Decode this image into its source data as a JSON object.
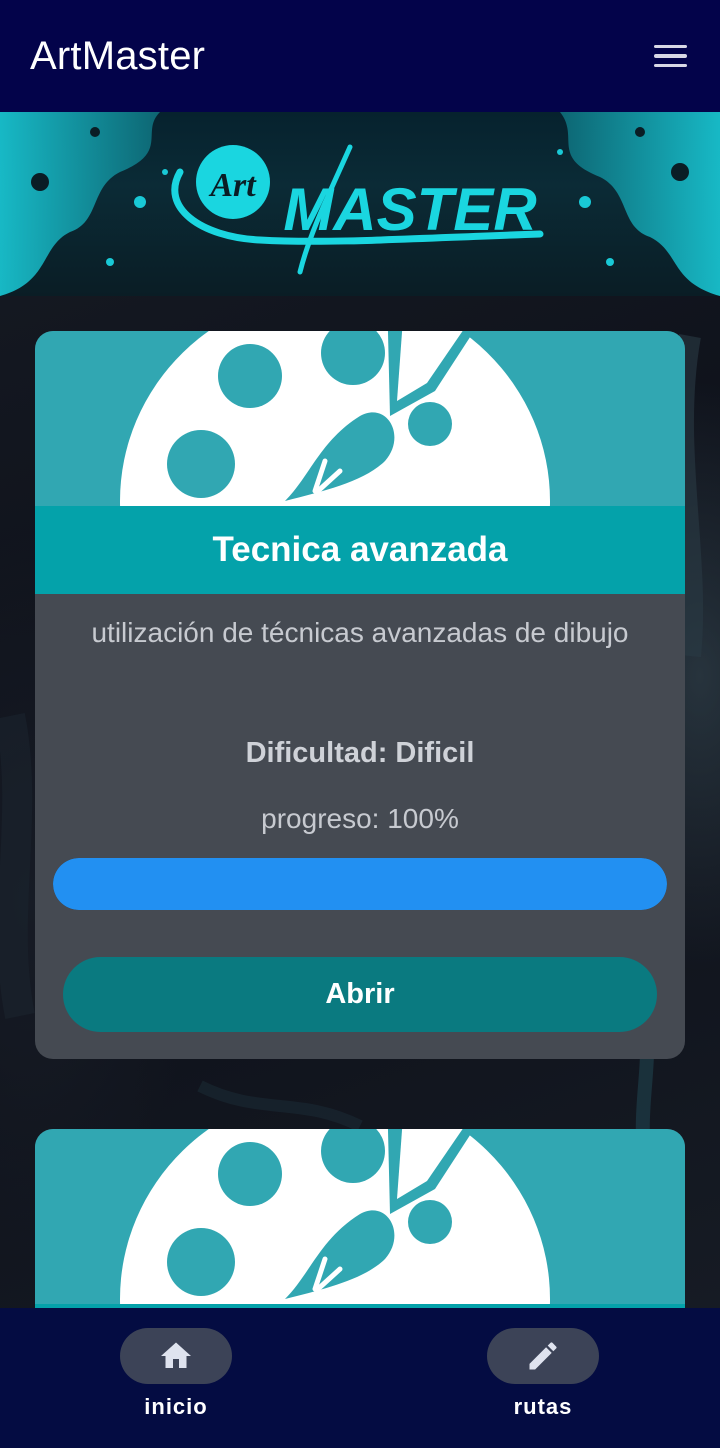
{
  "app_bar": {
    "title": "ArtMaster",
    "menu_icon": "menu-icon"
  },
  "banner": {
    "logo_small": "Art",
    "logo_main": "MASTER",
    "colors": {
      "accent": "#1ad6e0",
      "background": "#0a1d25"
    }
  },
  "cards": [
    {
      "image_icon": "palette-brush-icon",
      "title": "Tecnica avanzada",
      "description": "utilización de técnicas avanzadas de dibujo",
      "difficulty": "Dificultad: Dificil",
      "progress_text": "progreso: 100%",
      "progress_value": 1.0,
      "button_label": "Abrir"
    },
    {
      "image_icon": "palette-brush-icon"
    }
  ],
  "bottom_nav": {
    "items": [
      {
        "label": "inicio",
        "icon": "home-icon"
      },
      {
        "label": "rutas",
        "icon": "pencil-icon"
      }
    ]
  },
  "colors": {
    "app_bar": "#03034a",
    "card_title_bar": "#04a2aa",
    "progress": "#2290f2",
    "button": "#0a7a80",
    "bottom_nav": "#040c42"
  }
}
